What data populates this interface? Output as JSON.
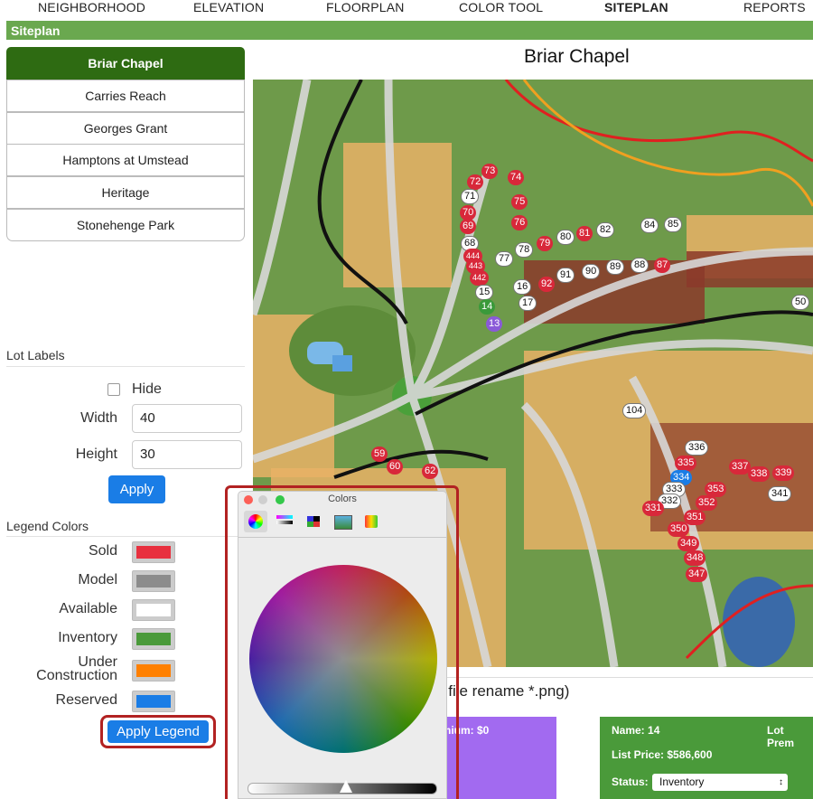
{
  "nav": [
    "NEIGHBORHOOD",
    "ELEVATION",
    "FLOORPLAN",
    "COLOR TOOL",
    "SITEPLAN",
    "REPORTS"
  ],
  "section_title": "Siteplan",
  "communities": [
    "Briar Chapel",
    "Carries Reach",
    "Georges Grant",
    "Hamptons at Umstead",
    "Heritage",
    "Stonehenge Park"
  ],
  "lot_labels": {
    "title": "Lot Labels",
    "hide_label": "Hide",
    "hide_checked": false,
    "width_label": "Width",
    "width_value": "40",
    "height_label": "Height",
    "height_value": "30",
    "apply": "Apply"
  },
  "legend": {
    "title": "Legend Colors",
    "items": [
      {
        "label": "Sold",
        "color": "#e8303f"
      },
      {
        "label": "Model",
        "color": "#8c8c8c"
      },
      {
        "label": "Available",
        "color": "#ffffff"
      },
      {
        "label": "Inventory",
        "color": "#4a9a3a"
      },
      {
        "label": "Under Construction",
        "color": "#ff8000"
      },
      {
        "label": "Reserved",
        "color": "#1a7de6"
      }
    ],
    "apply": "Apply Legend"
  },
  "map": {
    "title": "Briar Chapel",
    "lots_sold": [
      "73",
      "72",
      "70",
      "69",
      "74",
      "75",
      "76",
      "79",
      "81",
      "92",
      "87",
      "59",
      "60",
      "62",
      "335",
      "337",
      "338",
      "339",
      "353",
      "352",
      "351",
      "331",
      "350",
      "349",
      "348",
      "347",
      "444",
      "443",
      "442"
    ],
    "lots_available": [
      "71",
      "68",
      "77",
      "78",
      "80",
      "82",
      "84",
      "85",
      "91",
      "90",
      "89",
      "88",
      "16",
      "17",
      "15",
      "50",
      "104",
      "336",
      "333",
      "332",
      "341"
    ],
    "lots_inventory": [
      "14"
    ],
    "lots_reserved": [
      "13"
    ],
    "lots_blue": [
      "334"
    ]
  },
  "hint": "s file rename *.png)",
  "purple_card": "emium: $0",
  "green_card": {
    "name": "Name: 14",
    "premium": "Lot Prem",
    "price": "List Price: $586,600",
    "status_label": "Status:",
    "status_value": "Inventory"
  },
  "colors_panel": {
    "title": "Colors"
  }
}
